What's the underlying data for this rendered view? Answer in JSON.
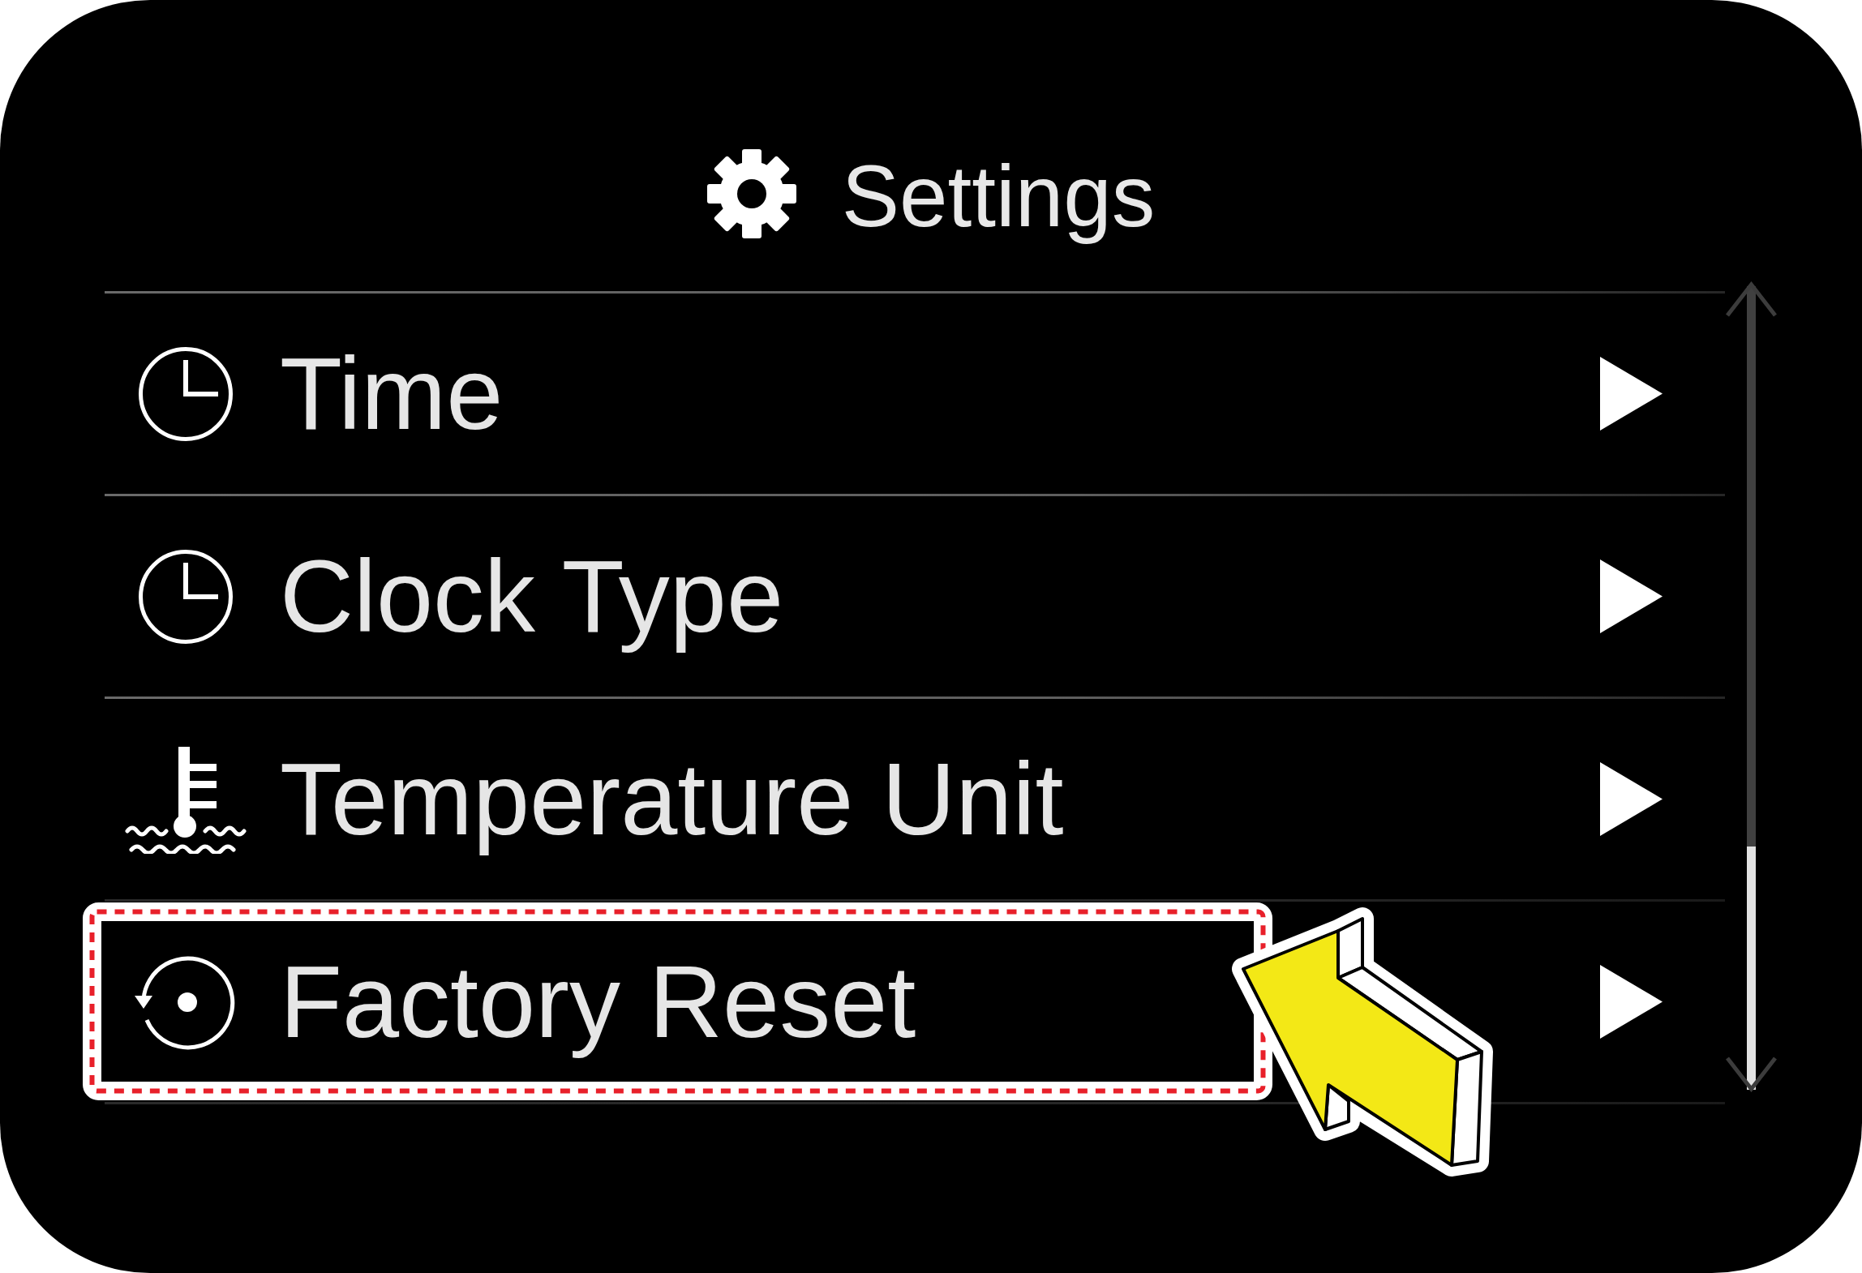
{
  "header": {
    "title": "Settings"
  },
  "menu": {
    "items": [
      {
        "kind": "clock",
        "label": "Time",
        "highlighted": false
      },
      {
        "kind": "clock",
        "label": "Clock Type",
        "highlighted": false
      },
      {
        "kind": "thermometer",
        "label": "Temperature Unit",
        "highlighted": false
      },
      {
        "kind": "reset",
        "label": "Factory Reset",
        "highlighted": true
      }
    ]
  }
}
